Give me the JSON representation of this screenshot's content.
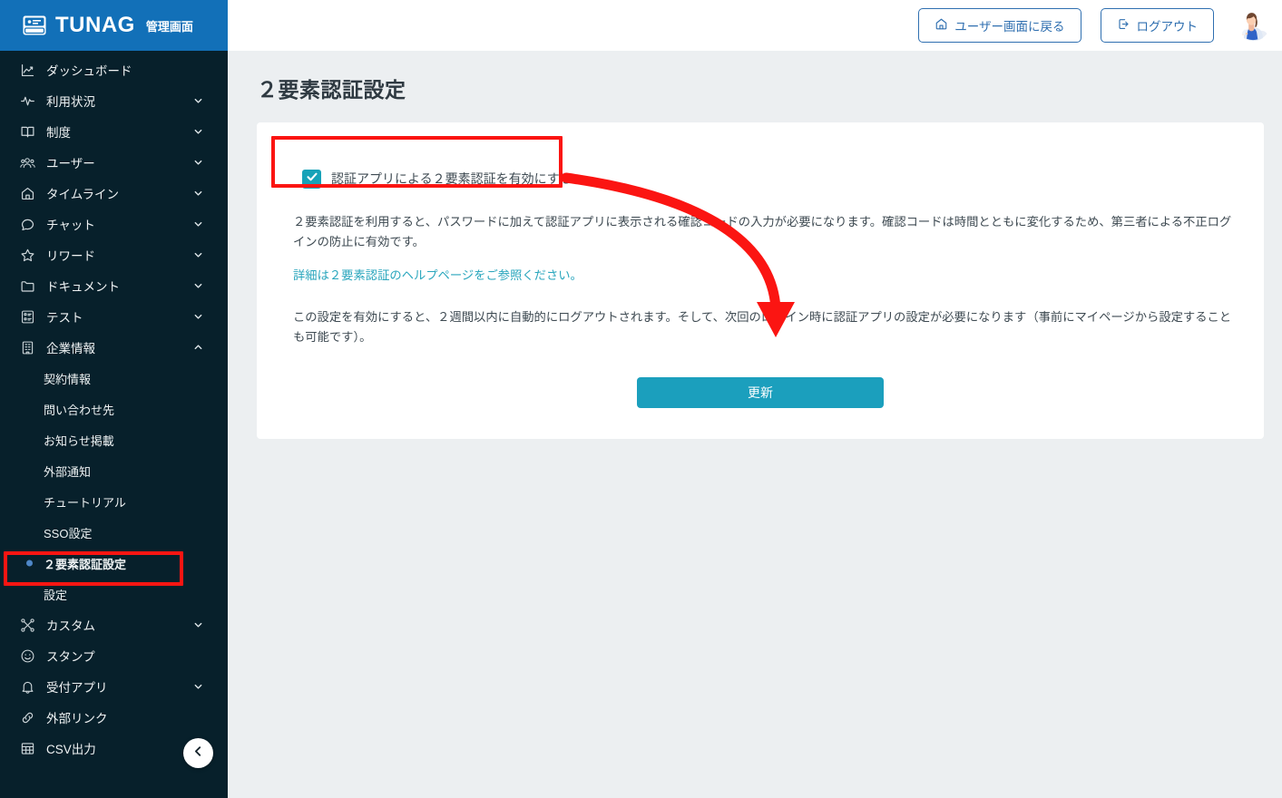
{
  "brand": {
    "logo_icon": "tunag-card-icon",
    "name": "TUNAG",
    "subtitle": "管理画面"
  },
  "topbar": {
    "back_to_user_label": "ユーザー画面に戻る",
    "back_icon": "home-icon",
    "logout_label": "ログアウト",
    "logout_icon": "logout-icon",
    "avatar_icon": "user-avatar"
  },
  "sidebar": {
    "collapse_icon": "chevron-left-icon",
    "items": [
      {
        "label": "ダッシュボード",
        "icon": "chart-line-icon",
        "expandable": false
      },
      {
        "label": "利用状況",
        "icon": "activity-icon",
        "expandable": true
      },
      {
        "label": "制度",
        "icon": "book-icon",
        "expandable": true
      },
      {
        "label": "ユーザー",
        "icon": "users-icon",
        "expandable": true
      },
      {
        "label": "タイムライン",
        "icon": "home-icon",
        "expandable": true
      },
      {
        "label": "チャット",
        "icon": "chat-icon",
        "expandable": true
      },
      {
        "label": "リワード",
        "icon": "star-icon",
        "expandable": true
      },
      {
        "label": "ドキュメント",
        "icon": "folder-icon",
        "expandable": true
      },
      {
        "label": "テスト",
        "icon": "clipboard-icon",
        "expandable": true
      },
      {
        "label": "企業情報",
        "icon": "building-icon",
        "expandable": true,
        "expanded": true
      }
    ],
    "company_sub_items": [
      {
        "label": "契約情報",
        "active": false
      },
      {
        "label": "問い合わせ先",
        "active": false
      },
      {
        "label": "お知らせ掲載",
        "active": false
      },
      {
        "label": "外部通知",
        "active": false
      },
      {
        "label": "チュートリアル",
        "active": false
      },
      {
        "label": "SSO設定",
        "active": false
      },
      {
        "label": "２要素認証設定",
        "active": true
      },
      {
        "label": "設定",
        "active": false
      }
    ],
    "items_after": [
      {
        "label": "カスタム",
        "icon": "scissors-icon",
        "expandable": true
      },
      {
        "label": "スタンプ",
        "icon": "smiley-icon",
        "expandable": false
      },
      {
        "label": "受付アプリ",
        "icon": "bell-icon",
        "expandable": true
      },
      {
        "label": "外部リンク",
        "icon": "link-icon",
        "expandable": false
      },
      {
        "label": "CSV出力",
        "icon": "table-icon",
        "expandable": false
      }
    ]
  },
  "main": {
    "page_title": "２要素認証設定",
    "checkbox": {
      "checked": true,
      "check_icon": "check-icon",
      "label": "認証アプリによる２要素認証を有効にする"
    },
    "paragraph_1": "２要素認証を利用すると、パスワードに加えて認証アプリに表示される確認コードの入力が必要になります。確認コードは時間とともに変化するため、第三者による不正ログインの防止に有効です。",
    "help_link": "詳細は２要素認証のヘルプページをご参照ください。",
    "paragraph_2": "この設定を有効にすると、２週間以内に自動的にログアウトされます。そして、次回のログイン時に認証アプリの設定が必要になります（事前にマイページから設定することも可能です）。",
    "update_button": "更新"
  },
  "annotations": {
    "highlight_color": "#fb1512",
    "boxes": [
      "checkbox-row",
      "sidebar-item-two-factor"
    ],
    "arrow": "curved-arrow-from-checkbox-to-update-button"
  },
  "colors": {
    "brand_blue": "#1270b8",
    "sidebar_bg": "#07202b",
    "accent_teal": "#17a2b8",
    "button_teal": "#1b9fbd",
    "annotation_red": "#fb1512",
    "page_bg": "#eceff1"
  }
}
